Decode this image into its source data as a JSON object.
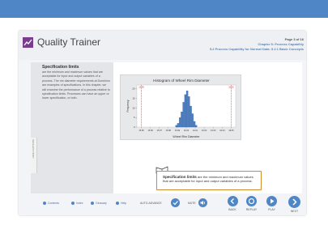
{
  "app": {
    "title": "Quality Trainer"
  },
  "header": {
    "page": "Page 3 of 16",
    "chapter": "Chapter 5: Process Capability",
    "section": "5.2 Process Capability for Normal Data: 5.2.1 Basic Concepts"
  },
  "sidebar": {
    "tab_label": "HIDE CAPTIONS",
    "title": "Specification limits",
    "text": "are the minimum and maximum values that are acceptable for input and output variables of a process. The rim diameter requirements at Dominion are examples of specifications. In this chapter, we will examine the performance of a process relative to specification limits. Processes can have an upper or lower specification, or both."
  },
  "chart_data": {
    "type": "bar",
    "title": "Histogram of Wheel Rim Diameter",
    "xlabel": "Wheel Rim Diameter",
    "ylabel": "Frequency",
    "x_ticks": [
      "15.95",
      "15.96",
      "15.97",
      "15.98",
      "15.99",
      "16.00",
      "16.01",
      "16.02",
      "16.03",
      "16.04",
      "16.05"
    ],
    "y_ticks": [
      0,
      5,
      10,
      15,
      20
    ],
    "ylim": [
      0,
      22
    ],
    "xlim": [
      15.945,
      16.055
    ],
    "spec_lines": [
      {
        "label": "15.95",
        "x": 15.95,
        "color": "#cc2222"
      },
      {
        "label": "16.05",
        "x": 16.05,
        "color": "#cc2222"
      }
    ],
    "bin_width": 0.002,
    "bins": [
      15.988,
      15.99,
      15.992,
      15.994,
      15.996,
      15.998,
      16.0,
      16.002,
      16.004,
      16.006,
      16.008,
      16.01
    ],
    "values": [
      1,
      2,
      5,
      8,
      13,
      17,
      19,
      16,
      11,
      7,
      3,
      1
    ],
    "bar_color": "#4f7fc0"
  },
  "callout": {
    "term": "Specification limits",
    "text": "are the minimum and maximum values that are acceptable for input and output variables of a process."
  },
  "footer": {
    "contents": "Contents",
    "index": "Index",
    "glossary": "Glossary",
    "help": "Help",
    "auto_advance": "AUTO-ADVANCE",
    "mute": "MUTE",
    "back": "BACK",
    "replay": "REPLAY",
    "play": "PLAY",
    "next": "NEXT"
  },
  "colors": {
    "accent": "#4f86c6",
    "brand": "#7a3d8e",
    "callout_border": "#d28a2e",
    "spec_line": "#cc2222"
  }
}
